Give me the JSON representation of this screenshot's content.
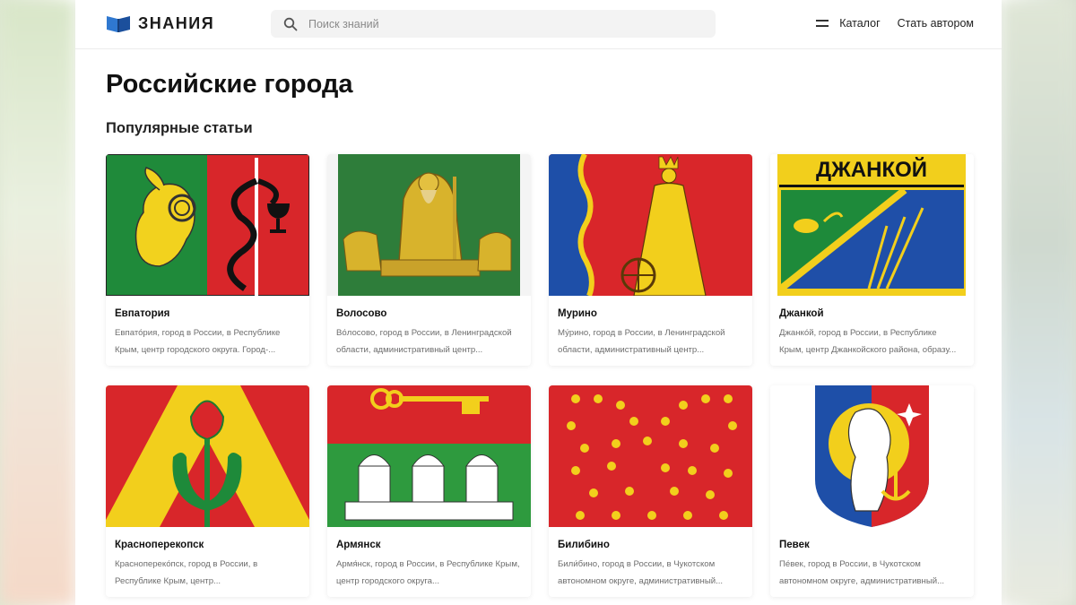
{
  "header": {
    "logo_text": "ЗНАНИЯ",
    "search_placeholder": "Поиск знаний",
    "catalog_label": "Каталог",
    "author_label": "Стать автором"
  },
  "main": {
    "title": "Российские города",
    "section_title": "Популярные статьи"
  },
  "cards": [
    {
      "title": "Евпатория",
      "desc": "Евпато́рия, город в России, в Республике Крым, центр городского округа. Город-..."
    },
    {
      "title": "Волосово",
      "desc": "Во́лосово, город в России, в Ленинградской области, административный центр..."
    },
    {
      "title": "Мурино",
      "desc": "Му́рино, город в России, в Ленинградской области, административный центр..."
    },
    {
      "title": "Джанкой",
      "desc": "Джанко́й, город в России, в Республике Крым, центр Джанкойского района, образу..."
    },
    {
      "title": "Красноперекопск",
      "desc": "Красноперeко́пск, город в России, в Республике Крым, центр..."
    },
    {
      "title": "Армянск",
      "desc": "Армя́нск, город в России, в Республике Крым, центр городского округа..."
    },
    {
      "title": "Билибино",
      "desc": "Били́бино, город в России, в Чукотском автономном округе, административный..."
    },
    {
      "title": "Певек",
      "desc": "Пе́век, город в России, в Чукотском автономном округе, административный..."
    }
  ],
  "emblem_texts": {
    "dzhankoy": "ДЖАНКОЙ"
  },
  "colors": {
    "accent_blue": "#1d5fb4",
    "page_bg": "#ffffff",
    "card_text": "#6d6d6d"
  }
}
